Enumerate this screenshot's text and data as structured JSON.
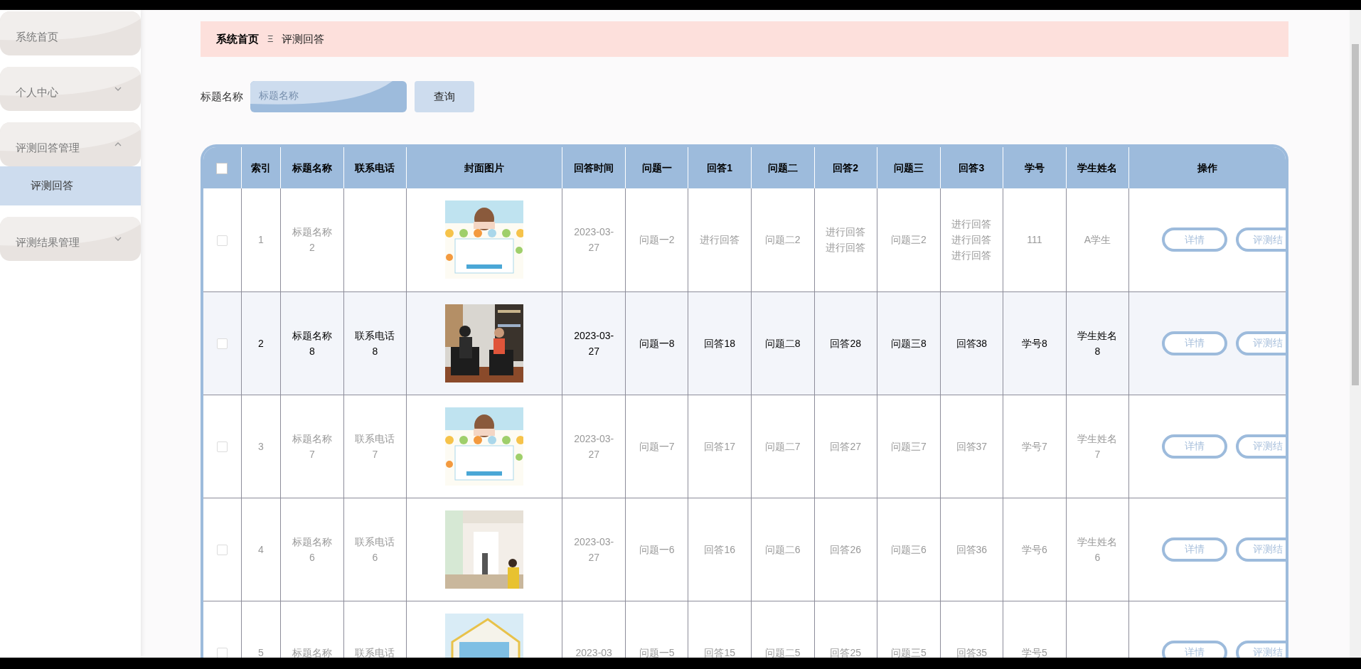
{
  "sidebar": {
    "items": [
      {
        "label": "系统首页",
        "kind": "link"
      },
      {
        "label": "个人中心",
        "kind": "group",
        "expanded": false
      },
      {
        "label": "评测回答管理",
        "kind": "group",
        "expanded": true,
        "children": [
          {
            "label": "评测回答",
            "selected": true
          }
        ]
      },
      {
        "label": "评测结果管理",
        "kind": "group",
        "expanded": false
      }
    ]
  },
  "breadcrumb": {
    "items": [
      "系统首页",
      "评测回答"
    ],
    "separator": "Ξ"
  },
  "search": {
    "label": "标题名称",
    "placeholder": "标题名称",
    "button": "查询"
  },
  "table": {
    "select_all": {
      "checked": false
    },
    "columns": [
      "索引",
      "标题名称",
      "联系电话",
      "封面图片",
      "回答时间",
      "问题一",
      "回答1",
      "问题二",
      "回答2",
      "问题三",
      "回答3",
      "学号",
      "学生姓名",
      "操作"
    ],
    "rows": [
      {
        "checked": false,
        "highlighted": false,
        "cells": [
          "1",
          "标题名称2",
          "",
          "",
          "2023-03-27",
          "问题一2",
          "进行回答",
          "问题二2",
          "进行回答进行回答",
          "问题三2",
          "进行回答进行回答进行回答",
          "111",
          "A学生"
        ],
        "actions": [
          "详情",
          "评测结"
        ]
      },
      {
        "checked": false,
        "highlighted": true,
        "cells": [
          "2",
          "标题名称8",
          "联系电话8",
          "",
          "2023-03-27",
          "问题一8",
          "回答18",
          "问题二8",
          "回答28",
          "问题三8",
          "回答38",
          "学号8",
          "学生姓名8"
        ],
        "actions": [
          "详情",
          "评测结"
        ]
      },
      {
        "checked": false,
        "highlighted": false,
        "cells": [
          "3",
          "标题名称7",
          "联系电话7",
          "",
          "2023-03-27",
          "问题一7",
          "回答17",
          "问题二7",
          "回答27",
          "问题三7",
          "回答37",
          "学号7",
          "学生姓名7"
        ],
        "actions": [
          "详情",
          "评测结"
        ]
      },
      {
        "checked": false,
        "highlighted": false,
        "cells": [
          "4",
          "标题名称6",
          "联系电话6",
          "",
          "2023-03-27",
          "问题一6",
          "回答16",
          "问题二6",
          "回答26",
          "问题三6",
          "回答36",
          "学号6",
          "学生姓名6"
        ],
        "actions": [
          "详情",
          "评测结"
        ]
      },
      {
        "checked": false,
        "highlighted": false,
        "cells": [
          "5",
          "标题名称",
          "联系电话",
          "",
          "2023-03",
          "问题一5",
          "回答15",
          "问题二5",
          "回答25",
          "问题三5",
          "回答35",
          "学号5",
          ""
        ],
        "actions": [
          "详情",
          "评测结"
        ]
      }
    ]
  }
}
